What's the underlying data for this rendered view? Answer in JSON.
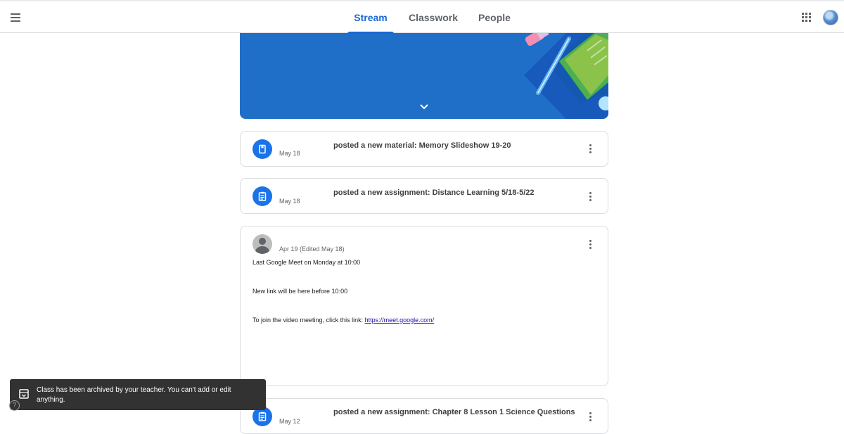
{
  "header": {
    "tabs": [
      {
        "label": "Stream"
      },
      {
        "label": "Classwork"
      },
      {
        "label": "People"
      }
    ],
    "menu_icon": "hamburger-menu-icon",
    "apps_icon": "google-apps-grid-icon"
  },
  "banner": {
    "expand_icon": "chevron-down-icon",
    "color": "#1f6fc8"
  },
  "stream": {
    "items": [
      {
        "title": "posted a new material: Memory Slideshow 19-20",
        "date": "May 18",
        "icon": "material-book-icon"
      },
      {
        "title": "posted a new assignment: Distance Learning 5/18-5/22",
        "date": "May 18",
        "icon": "assignment-clipboard-icon"
      },
      {
        "date": "Apr 19 (Edited May 18)",
        "lines": [
          "Last Google Meet on Monday at 10:00",
          "New link will be here before 10:00"
        ],
        "link_prefix": "To join the video meeting, click this link: ",
        "link_text": "https://meet.google.com/"
      },
      {
        "title": "posted a new assignment: Chapter 8 Lesson 1 Science Questions",
        "date": "May 12",
        "icon": "assignment-clipboard-icon"
      }
    ]
  },
  "snackbar": {
    "message": "Class has been archived by your teacher. You can't add or edit anything.",
    "icon": "archive-icon"
  },
  "help": {
    "label": "?"
  },
  "colors": {
    "accent": "#1967d2",
    "icon_bg": "#1a73e8",
    "snackbar_bg": "#323232"
  }
}
